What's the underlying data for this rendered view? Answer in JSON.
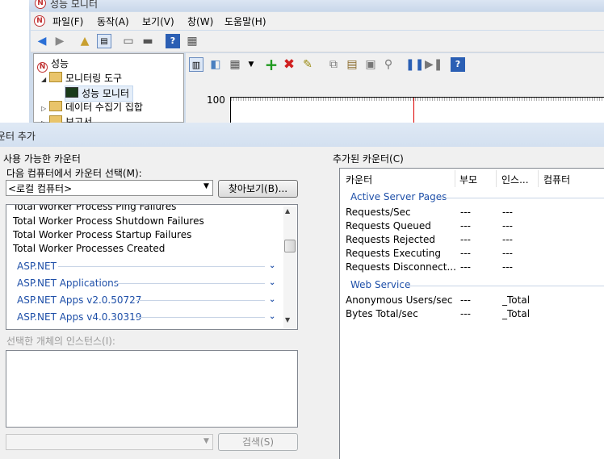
{
  "perfmon": {
    "title": "성능 모니터",
    "menu": [
      "파일(F)",
      "동작(A)",
      "보기(V)",
      "창(W)",
      "도움말(H)"
    ],
    "tree": {
      "root": "성능",
      "monitoring_tools": "모니터링 도구",
      "performance_monitor": "성능 모니터",
      "data_collector_sets": "데이터 수집기 집합",
      "reports": "보고서"
    },
    "graph": {
      "y_max": "100"
    }
  },
  "dialog": {
    "title": "운터 추가",
    "available_counters_label": "사용 가능한 카운터",
    "select_from_label": "다음 컴퓨터에서 카운터 선택(M):",
    "machine_value": "<로컬 컴퓨터>",
    "browse_button": "찾아보기(B)...",
    "counter_list": {
      "items": [
        "Total Worker Process Ping Failures",
        "Total Worker Process Shutdown Failures",
        "Total Worker Process Startup Failures",
        "Total Worker Processes Created"
      ],
      "categories": [
        "ASP.NET",
        "ASP.NET Applications",
        "ASP.NET Apps v2.0.50727",
        "ASP.NET Apps v4.0.30319"
      ]
    },
    "instances_label": "선택한 개체의 인스턴스(I):",
    "search_button": "검색(S)",
    "added_counters_label": "추가된 카운터(C)",
    "added_table": {
      "columns": [
        "카운터",
        "부모",
        "인스...",
        "컴퓨터"
      ],
      "groups": [
        {
          "name": "Active Server Pages",
          "rows": [
            {
              "counter": "Requests/Sec",
              "parent": "---",
              "instance": "---"
            },
            {
              "counter": "Requests Queued",
              "parent": "---",
              "instance": "---"
            },
            {
              "counter": "Requests Rejected",
              "parent": "---",
              "instance": "---"
            },
            {
              "counter": "Requests Executing",
              "parent": "---",
              "instance": "---"
            },
            {
              "counter": "Requests Disconnect...",
              "parent": "---",
              "instance": "---"
            }
          ]
        },
        {
          "name": "Web Service",
          "rows": [
            {
              "counter": "Anonymous Users/sec",
              "parent": "---",
              "instance": "_Total"
            },
            {
              "counter": "Bytes Total/sec",
              "parent": "---",
              "instance": "_Total"
            }
          ]
        }
      ]
    }
  }
}
